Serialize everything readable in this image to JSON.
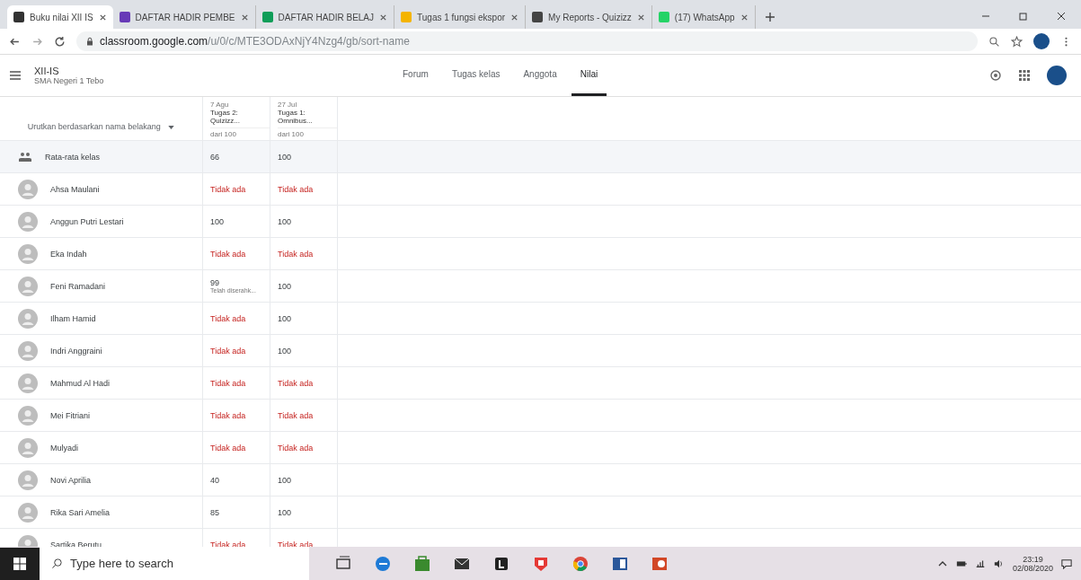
{
  "browser": {
    "tabs": [
      {
        "title": "Buku nilai XII IS",
        "selected": true
      },
      {
        "title": "DAFTAR HADIR PEMBE",
        "selected": false
      },
      {
        "title": "DAFTAR HADIR BELAJ",
        "selected": false
      },
      {
        "title": "Tugas 1 fungsi ekspor",
        "selected": false
      },
      {
        "title": "My Reports - Quizizz",
        "selected": false
      },
      {
        "title": "(17) WhatsApp",
        "selected": false
      }
    ],
    "url_host": "classroom.google.com",
    "url_path": "/u/0/c/MTE3ODAxNjY4Nzg4/gb/sort-name"
  },
  "class": {
    "name": "XII-IS",
    "subtitle": "SMA Negeri 1 Tebo"
  },
  "nav_tabs": [
    {
      "label": "Forum",
      "selected": false
    },
    {
      "label": "Tugas kelas",
      "selected": false
    },
    {
      "label": "Anggota",
      "selected": false
    },
    {
      "label": "Nilai",
      "selected": true
    }
  ],
  "sort_label": "Urutkan berdasarkan nama belakang",
  "columns": [
    {
      "date": "7 Agu",
      "title": "Tugas 2: Quizizz...",
      "points": "dari 100"
    },
    {
      "date": "27 Jul",
      "title": "Tugas 1: Omnibus...",
      "points": "dari 100"
    }
  ],
  "average": {
    "label": "Rata-rata kelas",
    "grades": [
      "66",
      "100"
    ]
  },
  "students": [
    {
      "name": "Ahsa Maulani",
      "grades": [
        {
          "kind": "missing",
          "text": "Tidak ada"
        },
        {
          "kind": "missing",
          "text": "Tidak ada"
        }
      ]
    },
    {
      "name": "Anggun Putri Lestari",
      "grades": [
        {
          "kind": "score",
          "text": "100"
        },
        {
          "kind": "score",
          "text": "100"
        }
      ]
    },
    {
      "name": "Eka Indah",
      "grades": [
        {
          "kind": "missing",
          "text": "Tidak ada"
        },
        {
          "kind": "missing",
          "text": "Tidak ada"
        }
      ]
    },
    {
      "name": "Feni Ramadani",
      "grades": [
        {
          "kind": "score",
          "text": "99",
          "note": "Telah diserahk..."
        },
        {
          "kind": "score",
          "text": "100"
        }
      ]
    },
    {
      "name": "Ilham Hamid",
      "grades": [
        {
          "kind": "missing",
          "text": "Tidak ada"
        },
        {
          "kind": "score",
          "text": "100"
        }
      ]
    },
    {
      "name": "Indri Anggraini",
      "grades": [
        {
          "kind": "missing",
          "text": "Tidak ada"
        },
        {
          "kind": "score",
          "text": "100"
        }
      ]
    },
    {
      "name": "Mahmud Al Hadi",
      "grades": [
        {
          "kind": "missing",
          "text": "Tidak ada"
        },
        {
          "kind": "missing",
          "text": "Tidak ada"
        }
      ]
    },
    {
      "name": "Mei Fitriani",
      "grades": [
        {
          "kind": "missing",
          "text": "Tidak ada"
        },
        {
          "kind": "missing",
          "text": "Tidak ada"
        }
      ]
    },
    {
      "name": "Mulyadi",
      "grades": [
        {
          "kind": "missing",
          "text": "Tidak ada"
        },
        {
          "kind": "missing",
          "text": "Tidak ada"
        }
      ]
    },
    {
      "name": "Novi Aprilia",
      "grades": [
        {
          "kind": "score",
          "text": "40"
        },
        {
          "kind": "score",
          "text": "100"
        }
      ]
    },
    {
      "name": "Rika Sari Amelia",
      "grades": [
        {
          "kind": "score",
          "text": "85"
        },
        {
          "kind": "score",
          "text": "100"
        }
      ]
    },
    {
      "name": "Sartika Berutu",
      "grades": [
        {
          "kind": "missing",
          "text": "Tidak ada"
        },
        {
          "kind": "missing",
          "text": "Tidak ada"
        }
      ]
    }
  ],
  "taskbar": {
    "search_placeholder": "Type here to search",
    "time": "23:19",
    "date": "02/08/2020"
  }
}
